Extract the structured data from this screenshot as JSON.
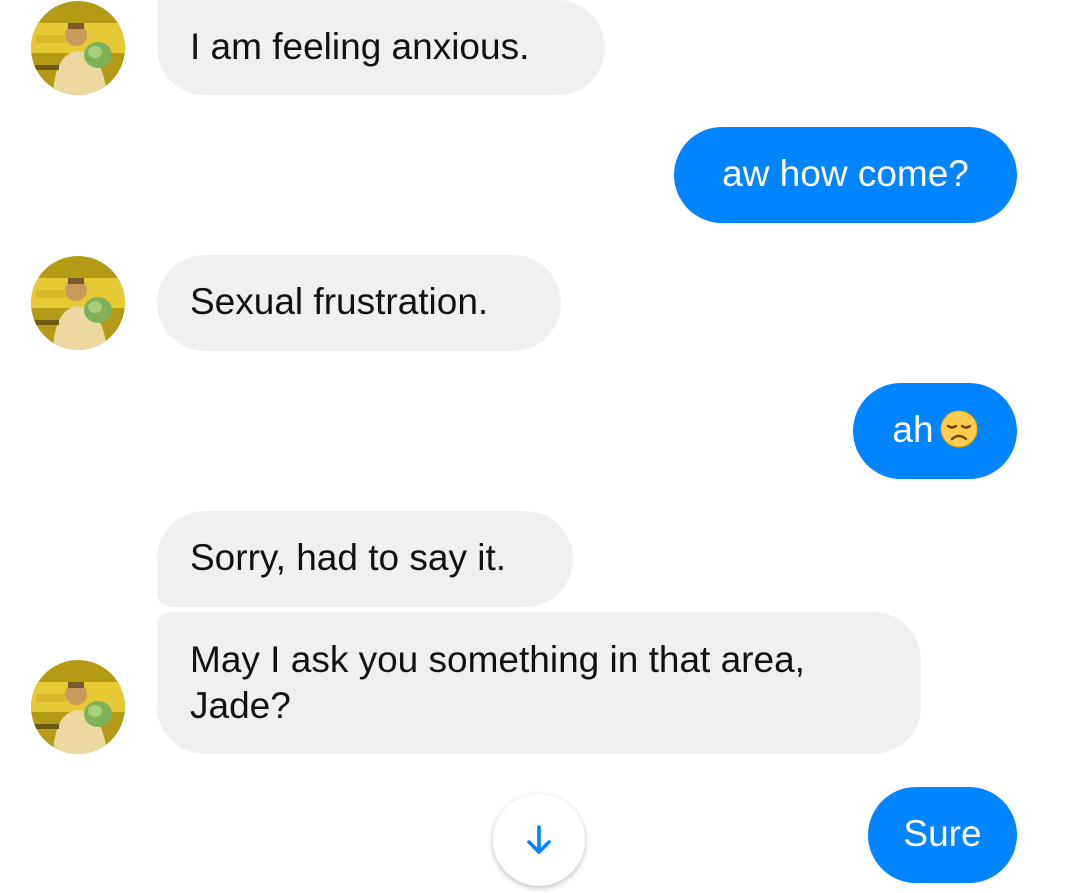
{
  "messages": [
    {
      "sender": "them",
      "text": "I am feeling anxious."
    },
    {
      "sender": "me",
      "text": "aw how come?"
    },
    {
      "sender": "them",
      "text": "Sexual frustration."
    },
    {
      "sender": "me",
      "text": "ah",
      "emoji": "disappointed-face"
    },
    {
      "sender": "them",
      "text": "Sorry, had to say it."
    },
    {
      "sender": "them",
      "text": "May I ask you something in that area, Jade?"
    },
    {
      "sender": "me",
      "text": "Sure"
    }
  ],
  "scroll_button": {
    "icon": "arrow-down-icon"
  },
  "colors": {
    "outgoing_bubble": "#0084ff",
    "incoming_bubble": "#f0f0f0",
    "accent": "#0084ff"
  }
}
